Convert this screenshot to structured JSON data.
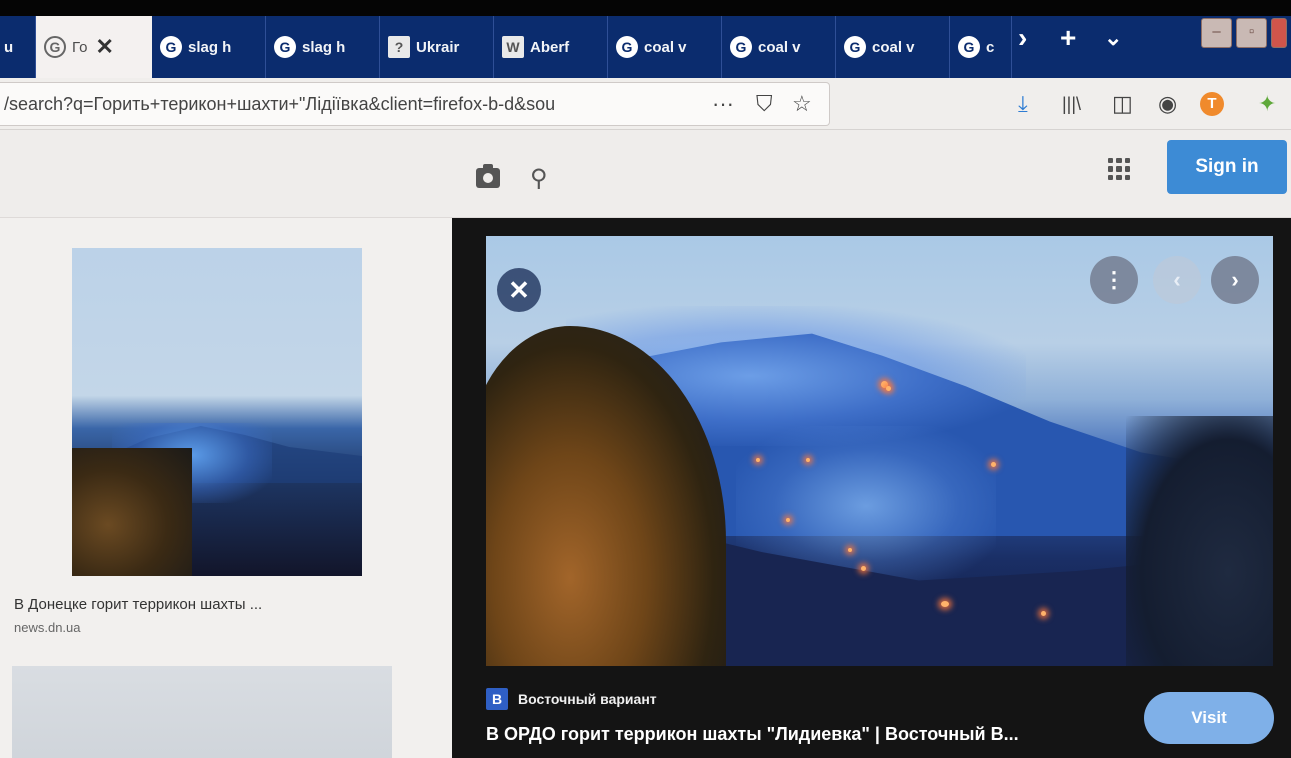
{
  "browser": {
    "tabs": [
      {
        "label": "u",
        "icon": ""
      },
      {
        "label": "Го",
        "icon": "google-icon",
        "active": true
      },
      {
        "label": "slag h",
        "icon": "google-icon"
      },
      {
        "label": "slag h",
        "icon": "google-icon"
      },
      {
        "label": "Ukrair",
        "icon": "question-icon"
      },
      {
        "label": "Aberf",
        "icon": "wikipedia-icon"
      },
      {
        "label": "coal v",
        "icon": "google-icon"
      },
      {
        "label": "coal v",
        "icon": "google-icon"
      },
      {
        "label": "coal v",
        "icon": "google-icon"
      },
      {
        "label": "c",
        "icon": "google-icon"
      }
    ],
    "tab_close_glyph": "✕",
    "overflow_glyph": "›",
    "new_tab_glyph": "+",
    "tab_list_glyph": "⌄",
    "url": "/search?q=Горить+терикон+шахти+\"Лідіївка&client=firefox-b-d&sou",
    "url_actions": {
      "more": "···",
      "pocket": "⛉",
      "bookmark": "☆"
    },
    "toolbar_icons": {
      "download": "⤓",
      "library": "|||\\",
      "sidebar": "◫",
      "account": "◉",
      "extension_t": "T",
      "extension_green": "✦"
    },
    "accent_color": "#0b2c6e"
  },
  "header": {
    "sign_in_label": "Sign in"
  },
  "results": [
    {
      "title": "В Донецке горит террикон шахты ...",
      "source": "news.dn.ua"
    }
  ],
  "preview": {
    "source_badge": "B",
    "source_name": "Восточный вариант",
    "title": "В ОРДО горит террикон шахты \"Лидиевка\" | Восточный В...",
    "visit_label": "Visit",
    "close_glyph": "✕",
    "more_glyph": "⋮",
    "prev_glyph": "‹",
    "next_glyph": "›"
  }
}
